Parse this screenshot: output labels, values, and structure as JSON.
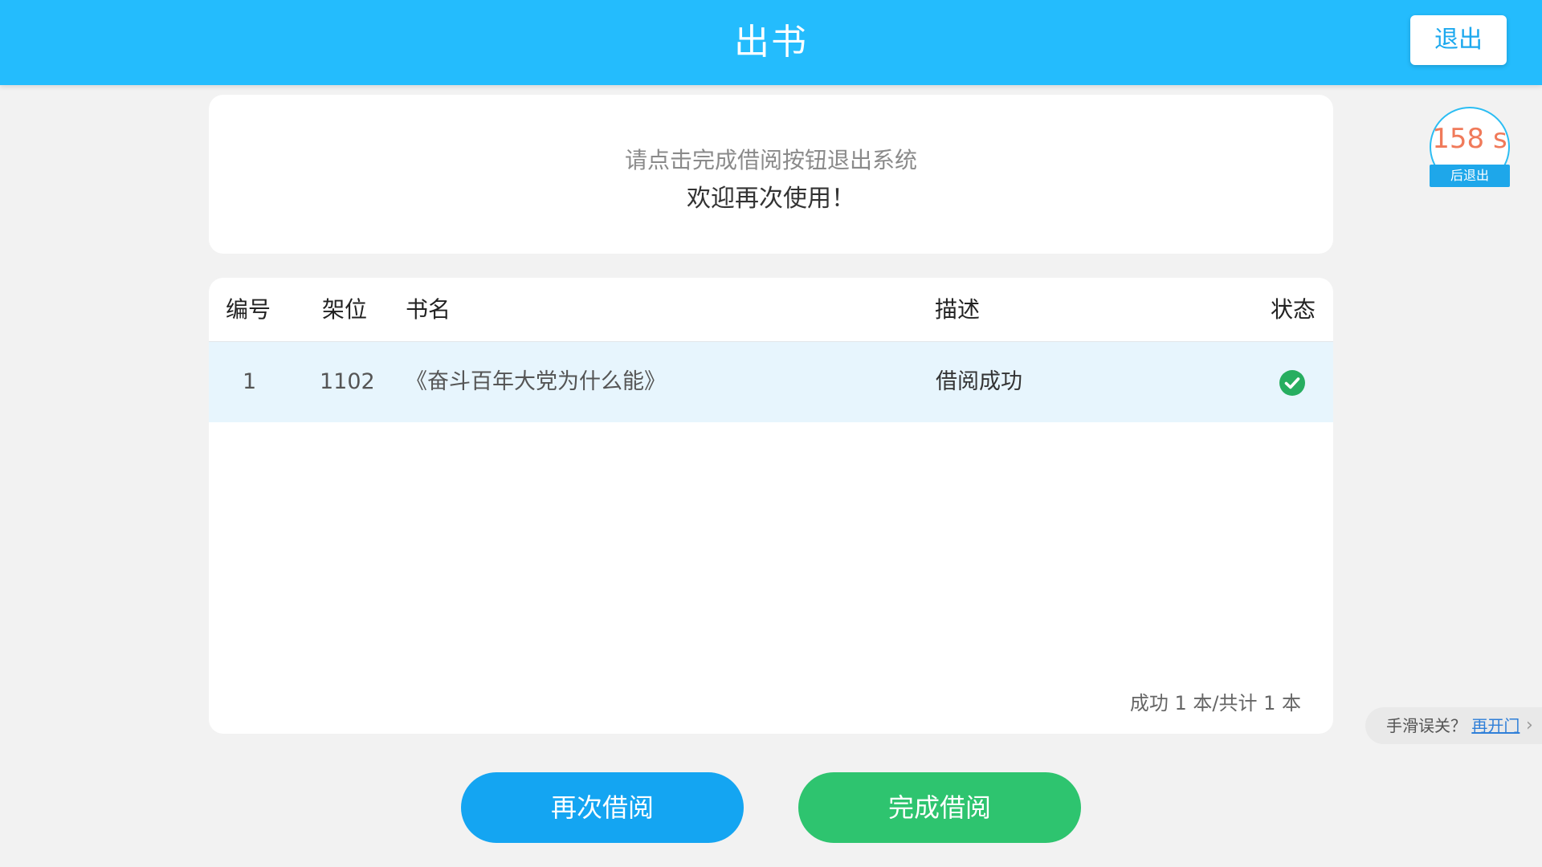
{
  "header": {
    "title": "出书",
    "exit_label": "退出"
  },
  "countdown": {
    "value": "158 s",
    "label": "后退出"
  },
  "message": {
    "line1": "请点击完成借阅按钮退出系统",
    "line2": "欢迎再次使用！"
  },
  "table": {
    "columns": [
      "编号",
      "架位",
      "书名",
      "描述",
      "状态"
    ],
    "rows": [
      {
        "id": "1",
        "shelf": "1102",
        "title": "《奋斗百年大党为什么能》",
        "desc": "借阅成功",
        "status_icon": "check-circle-icon"
      }
    ],
    "summary": "成功 1 本/共计 1 本"
  },
  "reopen": {
    "prompt": "手滑误关？",
    "link": "再开门"
  },
  "buttons": {
    "again": "再次借阅",
    "finish": "完成借阅"
  },
  "colors": {
    "header": "#24bcfd",
    "again_button": "#14a5f2",
    "finish_button": "#2ec46f",
    "success_icon": "#27ae60"
  }
}
